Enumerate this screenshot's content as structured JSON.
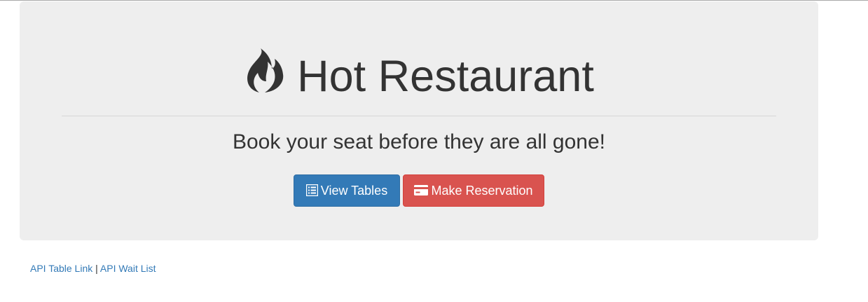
{
  "jumbotron": {
    "title": "Hot Restaurant",
    "title_icon": "fire-icon",
    "tagline": "Book your seat before they are all gone!"
  },
  "buttons": {
    "view_tables": {
      "label": "View Tables",
      "icon": "list-alt-icon",
      "color": "#337ab7"
    },
    "make_reservation": {
      "label": "Make Reservation",
      "icon": "credit-card-icon",
      "color": "#d9534f"
    }
  },
  "footer_links": {
    "api_table": "API Table Link",
    "separator": "|",
    "api_wait": "API Wait List",
    "link_color": "#337ab7"
  },
  "colors": {
    "jumbotron_bg": "#eeeeee",
    "text": "#333333"
  }
}
